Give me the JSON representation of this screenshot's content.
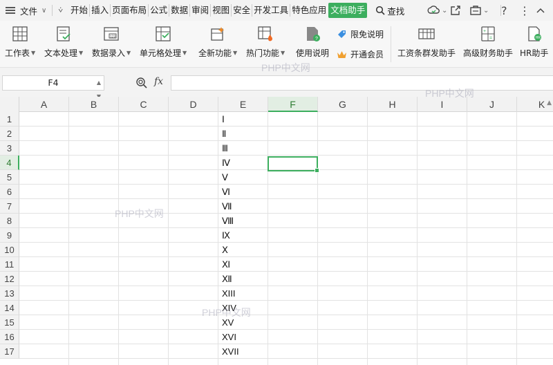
{
  "menubar": {
    "file_label": "文件",
    "tabs": [
      "开始",
      "插入",
      "页面布局",
      "公式",
      "数据",
      "审阅",
      "视图",
      "安全",
      "开发工具",
      "特色应用"
    ],
    "active_tab": "文档助手",
    "search_label": "查找",
    "accent": "#3cae5e"
  },
  "ribbon": {
    "items": [
      {
        "label": "工作表",
        "icon": "worksheet-icon"
      },
      {
        "label": "文本处理",
        "icon": "text-process-icon"
      },
      {
        "label": "数据录入",
        "icon": "data-entry-icon"
      },
      {
        "label": "单元格处理",
        "icon": "cell-process-icon"
      },
      {
        "label": "全新功能",
        "icon": "new-feature-icon"
      },
      {
        "label": "热门功能",
        "icon": "hot-feature-icon"
      },
      {
        "label": "使用说明",
        "icon": "usage-guide-icon"
      }
    ],
    "limited_free": "限免说明",
    "membership": "开通会员",
    "salary_assistant": "工资条群发助手",
    "finance_assistant": "高级财务助手",
    "hr_assistant": "HR助手"
  },
  "formula_bar": {
    "name_box": "F4",
    "fx": "fx",
    "formula": ""
  },
  "sheet": {
    "columns": [
      "A",
      "B",
      "C",
      "D",
      "E",
      "F",
      "G",
      "H",
      "I",
      "J",
      "K"
    ],
    "selected_column": "F",
    "rows": [
      "1",
      "2",
      "3",
      "4",
      "5",
      "6",
      "7",
      "8",
      "9",
      "10",
      "11",
      "12",
      "13",
      "14",
      "15",
      "16",
      "17"
    ],
    "selected_row": "4",
    "active_cell": "F4",
    "column_e_values": [
      "Ⅰ",
      "Ⅱ",
      "Ⅲ",
      "Ⅳ",
      "Ⅴ",
      "Ⅵ",
      "Ⅶ",
      "Ⅷ",
      "Ⅸ",
      "Ⅹ",
      "Ⅺ",
      "Ⅻ",
      "XIII",
      "XIV",
      "XV",
      "XVI",
      "XVII"
    ]
  },
  "watermark": "PHP中文网"
}
